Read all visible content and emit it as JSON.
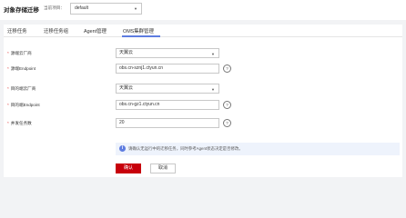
{
  "header": {
    "title": "对象存储迁移",
    "region_label": "当前项目：",
    "region_value": "default"
  },
  "tabs": [
    "迁移任务",
    "迁移任务组",
    "Agent管理",
    "OMS集群管理"
  ],
  "form": {
    "rows": [
      {
        "label": "源端云厂商",
        "value": "天翼云",
        "type": "select",
        "help": false
      },
      {
        "label": "源端Endpoint",
        "value": "obs.cn-sznj1.ctyun.cn",
        "type": "input",
        "help": true
      },
      {
        "label": "目的端云厂商",
        "value": "天翼云",
        "type": "select",
        "help": false
      },
      {
        "label": "目的端Endpoint",
        "value": "obs.cn-gz1.ctyun.cn",
        "type": "input",
        "help": true
      },
      {
        "label": "并发任务数",
        "value": "20",
        "type": "input",
        "help": true
      }
    ],
    "required_mark": "*",
    "help_glyph": "?"
  },
  "notice": {
    "icon": "info-icon",
    "text": "请确认无运行中的迁移任务，同时参考Agent状态决定是否修改。"
  },
  "buttons": {
    "confirm": "确认",
    "cancel": "取消"
  },
  "colors": {
    "accent": "#5e7ce0",
    "primary_button": "#c7000b",
    "required": "#e03c3c",
    "notice_bg": "#eef3fc"
  }
}
